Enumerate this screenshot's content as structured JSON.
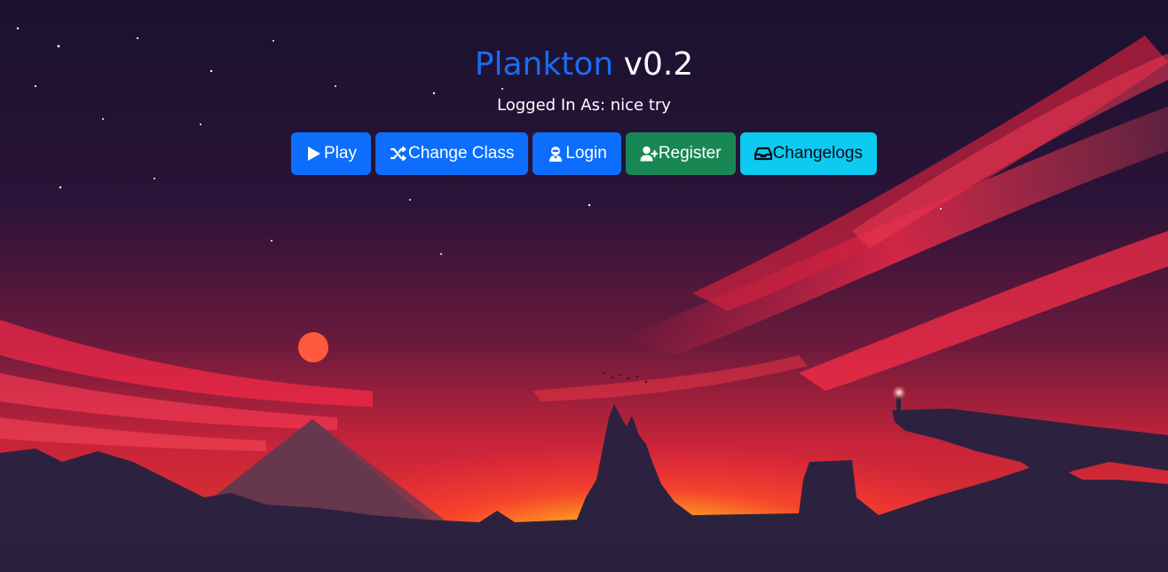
{
  "header": {
    "title_brand": "Plankton",
    "title_version": "v0.2",
    "status_text": "Logged In As: nice try"
  },
  "buttons": [
    {
      "label": "Play",
      "icon": "play-icon",
      "color": "#0d6efd"
    },
    {
      "label": "Change Class",
      "icon": "shuffle-icon",
      "color": "#0d6efd"
    },
    {
      "label": "Login",
      "icon": "user-secret-icon",
      "color": "#0d6efd"
    },
    {
      "label": "Register",
      "icon": "user-plus-icon",
      "color": "#198754"
    },
    {
      "label": "Changelogs",
      "icon": "inbox-icon",
      "color": "#0dcaf0"
    }
  ],
  "colors": {
    "brand": "#1a6cf0",
    "sky_top": "#1c1231",
    "sun": "#ff5a3c",
    "silhouette": "#2b2040"
  }
}
